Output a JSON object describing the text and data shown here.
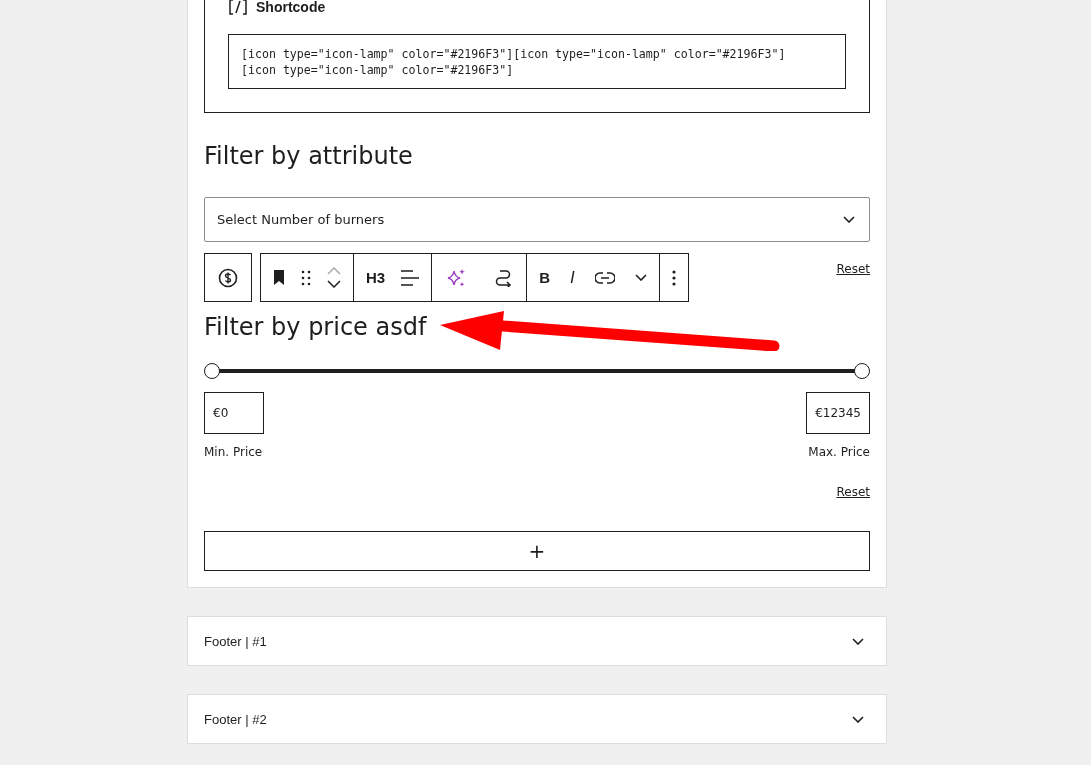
{
  "shortcode_block": {
    "title": "Shortcode",
    "code_lines": [
      "[icon type=\"icon-lamp\" color=\"#2196F3\"][icon type=\"icon-lamp\" color=\"#2196F3\"]",
      "[icon type=\"icon-lamp\" color=\"#2196F3\"]"
    ]
  },
  "attribute_heading": "Filter by attribute",
  "attribute_select": {
    "value": "Select Number of burners"
  },
  "toolbar": {
    "groups": [
      [
        {
          "kind": "bookmark"
        },
        {
          "kind": "drag"
        },
        {
          "kind": "mover"
        }
      ],
      [
        {
          "kind": "text",
          "label": "H3"
        },
        {
          "kind": "align"
        }
      ],
      [
        {
          "kind": "sparkle"
        },
        {
          "kind": "loop"
        }
      ],
      [
        {
          "kind": "text",
          "label": "B"
        },
        {
          "kind": "italic",
          "label": "I"
        },
        {
          "kind": "link"
        },
        {
          "kind": "chevron"
        }
      ],
      [
        {
          "kind": "more"
        }
      ]
    ]
  },
  "reset_top": "Reset",
  "price_heading": "Filter by price asdf",
  "price_slider": {
    "thumbs": [
      {
        "level": 0
      },
      {
        "level": 1
      }
    ]
  },
  "min_price": {
    "value": "€0",
    "label": "Min. Price"
  },
  "max_price": {
    "value": "€12345",
    "label": "Max. Price"
  },
  "reset_bottom": "Reset",
  "add_block": "+",
  "footers": [
    {
      "title": "Footer | #1",
      "expanded": false
    },
    {
      "title": "Footer | #2",
      "expanded": false
    }
  ]
}
